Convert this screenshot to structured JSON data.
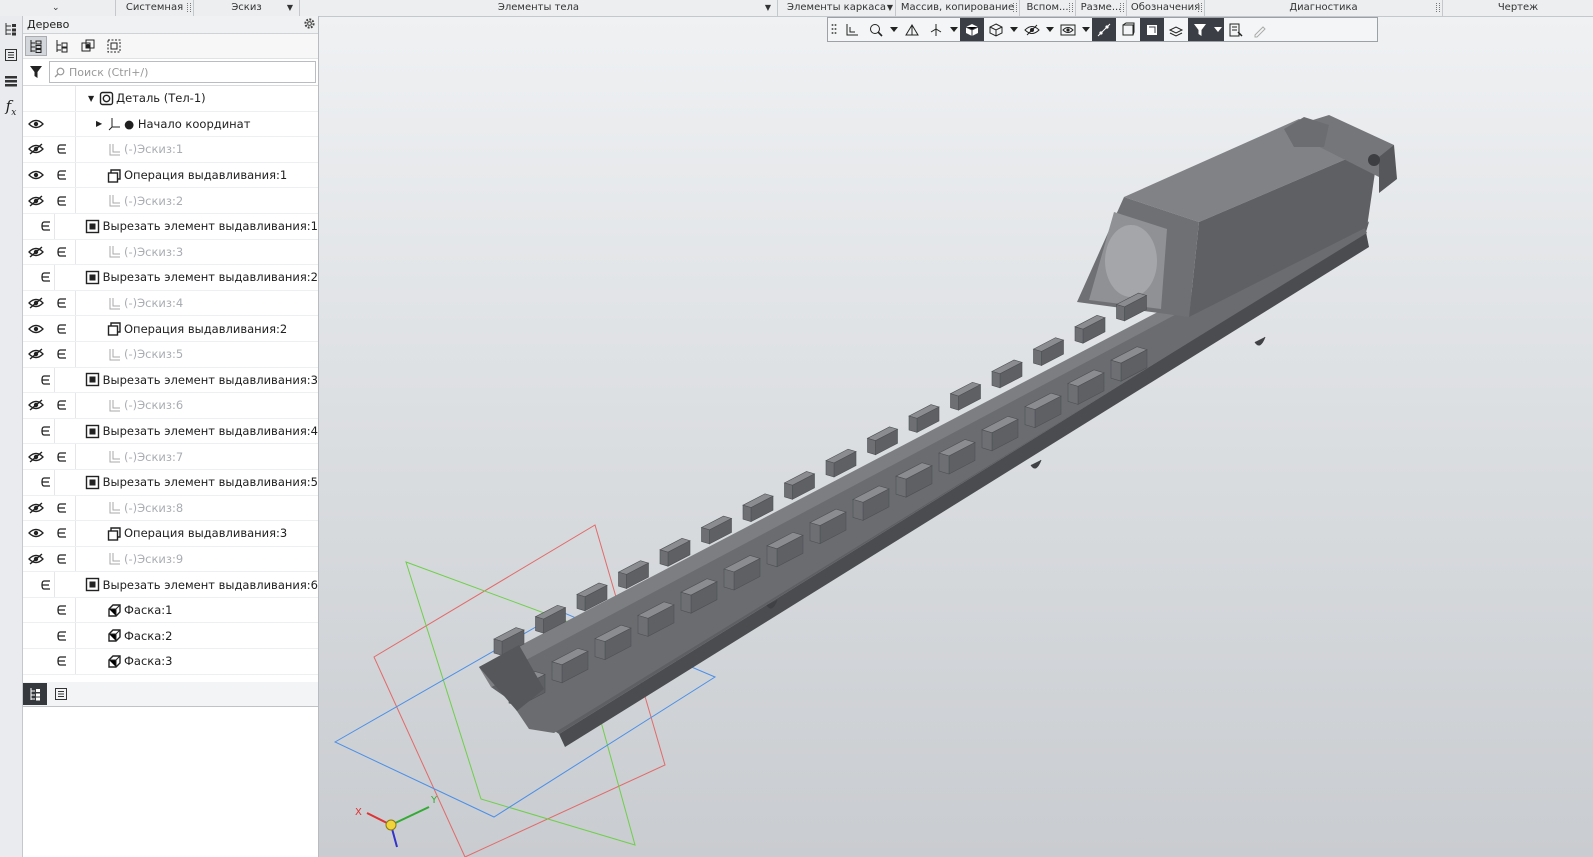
{
  "ribbon": {
    "tabs": [
      {
        "label": ""
      },
      {
        "label": "Системная"
      },
      {
        "label": "Эскиз"
      },
      {
        "label": "Элементы тела"
      },
      {
        "label": "Элементы каркаса"
      },
      {
        "label": "Массив, копирование"
      },
      {
        "label": "Вспом..."
      },
      {
        "label": "Разме..."
      },
      {
        "label": "Обозначения"
      },
      {
        "label": "Диагностика"
      },
      {
        "label": "Чертеж"
      }
    ]
  },
  "side_icons": [
    "tree-icon",
    "properties-icon",
    "layers-icon",
    "variables-icon"
  ],
  "panel": {
    "title": "Дерево",
    "search_placeholder": "Поиск (Ctrl+/)",
    "tree": [
      {
        "label": "Деталь (Тел-1)",
        "eye": "",
        "type": "part",
        "dim": false
      },
      {
        "label": "● Начало координат",
        "eye": "visible",
        "type": "origin",
        "dim": false
      },
      {
        "label": "(-)Эскиз:1",
        "eye": "hidden",
        "type": "sketch",
        "dim": true
      },
      {
        "label": "Операция выдавливания:1",
        "eye": "visible",
        "type": "extrude",
        "dim": false
      },
      {
        "label": "(-)Эскиз:2",
        "eye": "hidden",
        "type": "sketch",
        "dim": true
      },
      {
        "label": "Вырезать элемент выдавливания:1",
        "eye": "",
        "type": "cut",
        "dim": false
      },
      {
        "label": "(-)Эскиз:3",
        "eye": "hidden",
        "type": "sketch",
        "dim": true
      },
      {
        "label": "Вырезать элемент выдавливания:2",
        "eye": "",
        "type": "cut",
        "dim": false
      },
      {
        "label": "(-)Эскиз:4",
        "eye": "hidden",
        "type": "sketch",
        "dim": true
      },
      {
        "label": "Операция выдавливания:2",
        "eye": "visible",
        "type": "extrude",
        "dim": false
      },
      {
        "label": "(-)Эскиз:5",
        "eye": "hidden",
        "type": "sketch",
        "dim": true
      },
      {
        "label": "Вырезать элемент выдавливания:3",
        "eye": "",
        "type": "cut",
        "dim": false
      },
      {
        "label": "(-)Эскиз:6",
        "eye": "hidden",
        "type": "sketch",
        "dim": true
      },
      {
        "label": "Вырезать элемент выдавливания:4",
        "eye": "",
        "type": "cut",
        "dim": false
      },
      {
        "label": "(-)Эскиз:7",
        "eye": "hidden",
        "type": "sketch",
        "dim": true
      },
      {
        "label": "Вырезать элемент выдавливания:5",
        "eye": "",
        "type": "cut",
        "dim": false
      },
      {
        "label": "(-)Эскиз:8",
        "eye": "hidden",
        "type": "sketch",
        "dim": true
      },
      {
        "label": "Операция выдавливания:3",
        "eye": "visible",
        "type": "extrude",
        "dim": false
      },
      {
        "label": "(-)Эскиз:9",
        "eye": "hidden",
        "type": "sketch",
        "dim": true
      },
      {
        "label": "Вырезать элемент выдавливания:6",
        "eye": "",
        "type": "cut",
        "dim": false
      },
      {
        "label": "Фаска:1",
        "eye": "",
        "type": "chamfer",
        "dim": false
      },
      {
        "label": "Фаска:2",
        "eye": "",
        "type": "chamfer",
        "dim": false
      },
      {
        "label": "Фаска:3",
        "eye": "",
        "type": "chamfer",
        "dim": false
      }
    ]
  },
  "viewport": {
    "axis_labels": {
      "x": "X",
      "y": "Y"
    },
    "colors": {
      "plane_xy": "#4a8fe8",
      "plane_zx": "#e26a6a",
      "plane_zy": "#6ecf4a",
      "model": "#6f7175"
    }
  }
}
